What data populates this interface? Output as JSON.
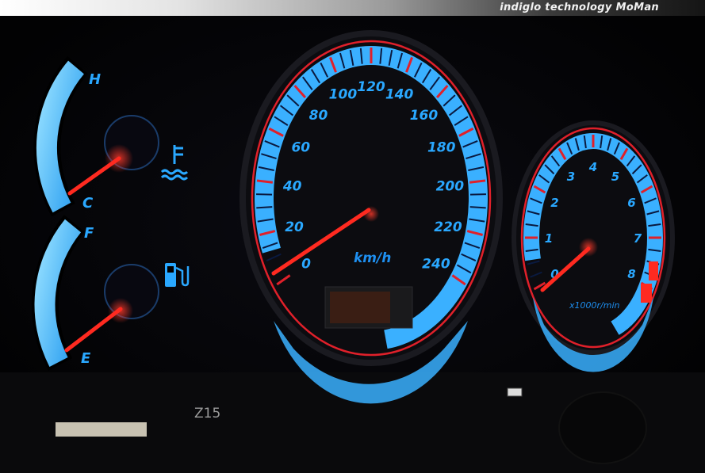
{
  "banner": {
    "prefix": "indiglo technology",
    "brand": "MoMan"
  },
  "temp_gauge": {
    "hot_label": "H",
    "cold_label": "C",
    "icon": "coolant-temperature-icon"
  },
  "fuel_gauge": {
    "full_label": "F",
    "empty_label": "E",
    "icon": "fuel-pump-icon"
  },
  "speedometer": {
    "unit": "km/h",
    "scale_labels": [
      "0",
      "20",
      "40",
      "60",
      "80",
      "100",
      "120",
      "140",
      "160",
      "180",
      "200",
      "220",
      "240"
    ],
    "needle_value": 8
  },
  "tachometer": {
    "unit": "x1000r/min",
    "scale_labels": [
      "0",
      "1",
      "2",
      "3",
      "4",
      "5",
      "6",
      "7",
      "8"
    ],
    "needle_value": 0.3
  },
  "dash_stamp": "Z15",
  "colors": {
    "glow_blue": "#2aa8ff",
    "needle_red": "#ff2a20",
    "ring_red": "#e0202a",
    "label_blue": "#1e8ff0"
  }
}
